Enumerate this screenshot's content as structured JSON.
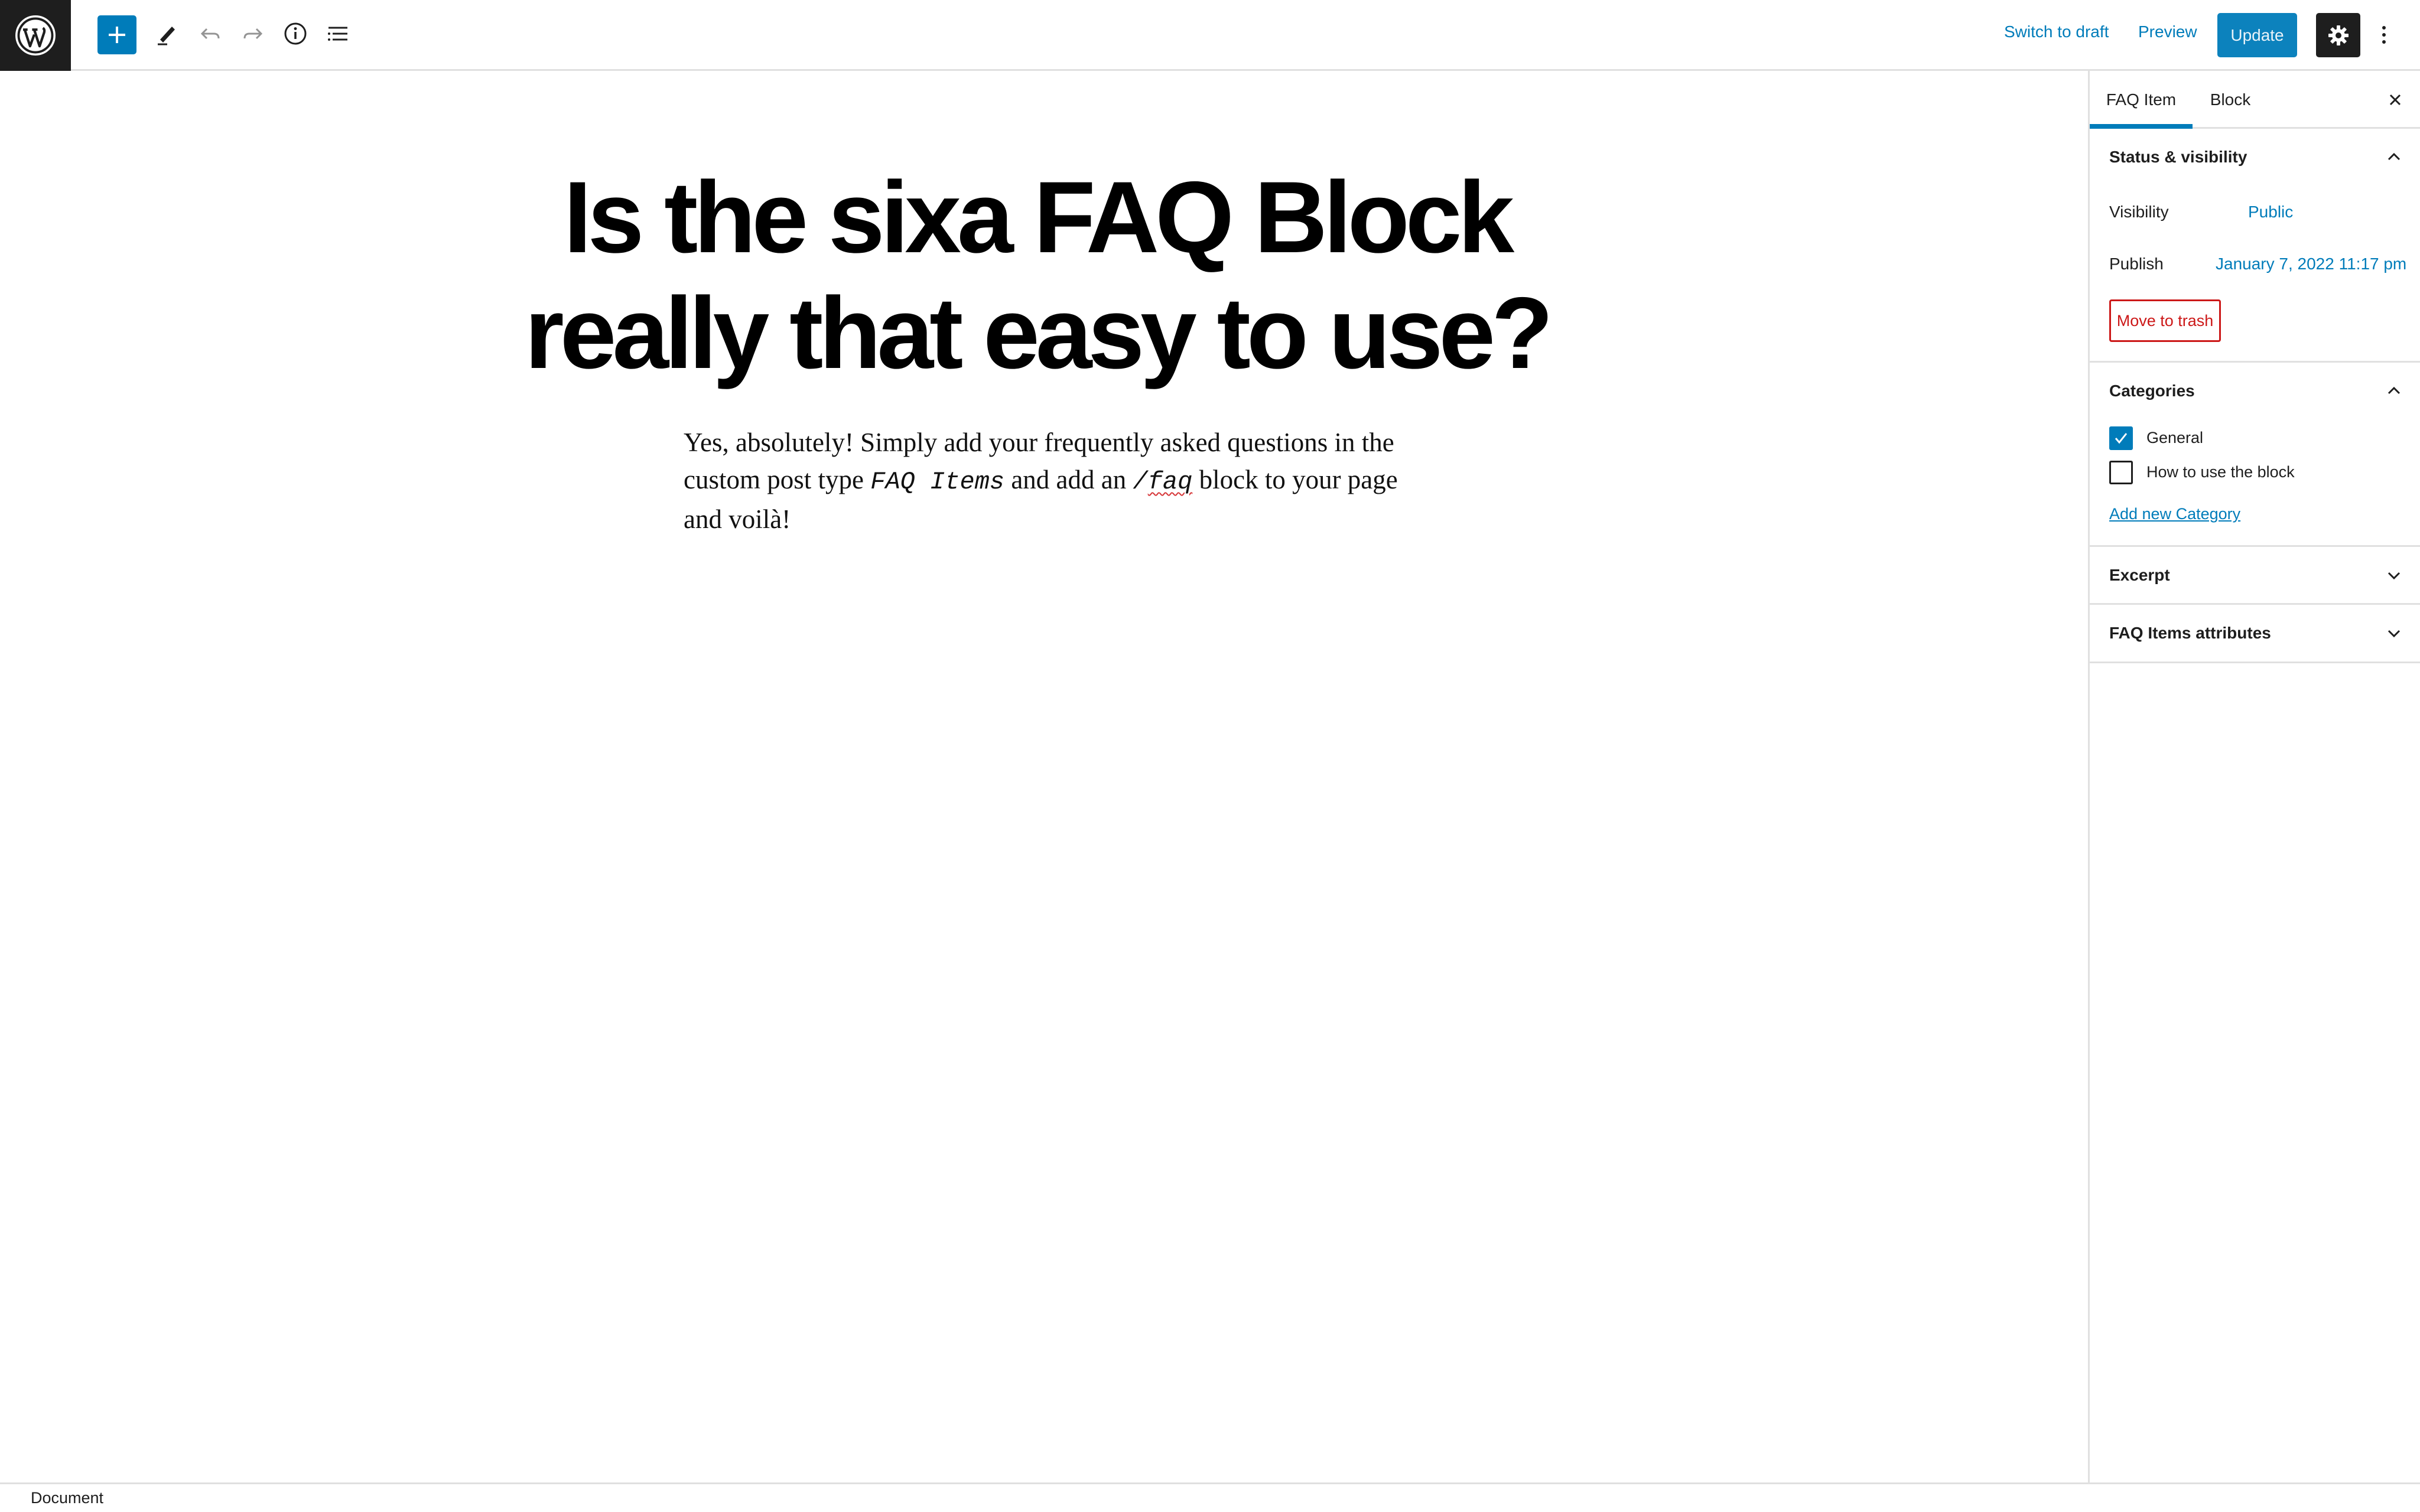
{
  "toolbar": {
    "add_block_label": "Add block",
    "tools_label": "Tools",
    "undo_label": "Undo",
    "redo_label": "Redo",
    "details_label": "Details",
    "list_view_label": "List View",
    "switch_to_draft": "Switch to draft",
    "preview": "Preview",
    "update": "Update",
    "settings_label": "Settings",
    "options_label": "Options",
    "accent_color": "#007cba"
  },
  "post": {
    "title_line1": "Is the sixa FAQ Block",
    "title_line2": "really that easy to use?",
    "body_part1": "Yes, absolutely! Simply add your frequently asked questions in the custom post type ",
    "body_code1": "FAQ Items",
    "body_part2": " and add an ",
    "body_code2_prefix": "/",
    "body_code2_word": "faq",
    "body_part3": " block to your page and voilà!"
  },
  "sidebar": {
    "tabs": [
      {
        "label": "FAQ Item",
        "active": true
      },
      {
        "label": "Block",
        "active": false
      }
    ],
    "status_visibility": {
      "title": "Status & visibility",
      "expanded": true,
      "visibility_label": "Visibility",
      "visibility_value": "Public",
      "publish_label": "Publish",
      "publish_value": "January 7, 2022 11:17 pm",
      "trash_button": "Move to trash"
    },
    "categories": {
      "title": "Categories",
      "expanded": true,
      "items": [
        {
          "label": "General",
          "checked": true
        },
        {
          "label": "How to use the block",
          "checked": false
        }
      ],
      "add_new": "Add new Category"
    },
    "excerpt": {
      "title": "Excerpt",
      "expanded": false
    },
    "faq_attributes": {
      "title": "FAQ Items attributes",
      "expanded": false
    }
  },
  "footer": {
    "breadcrumb": "Document"
  }
}
